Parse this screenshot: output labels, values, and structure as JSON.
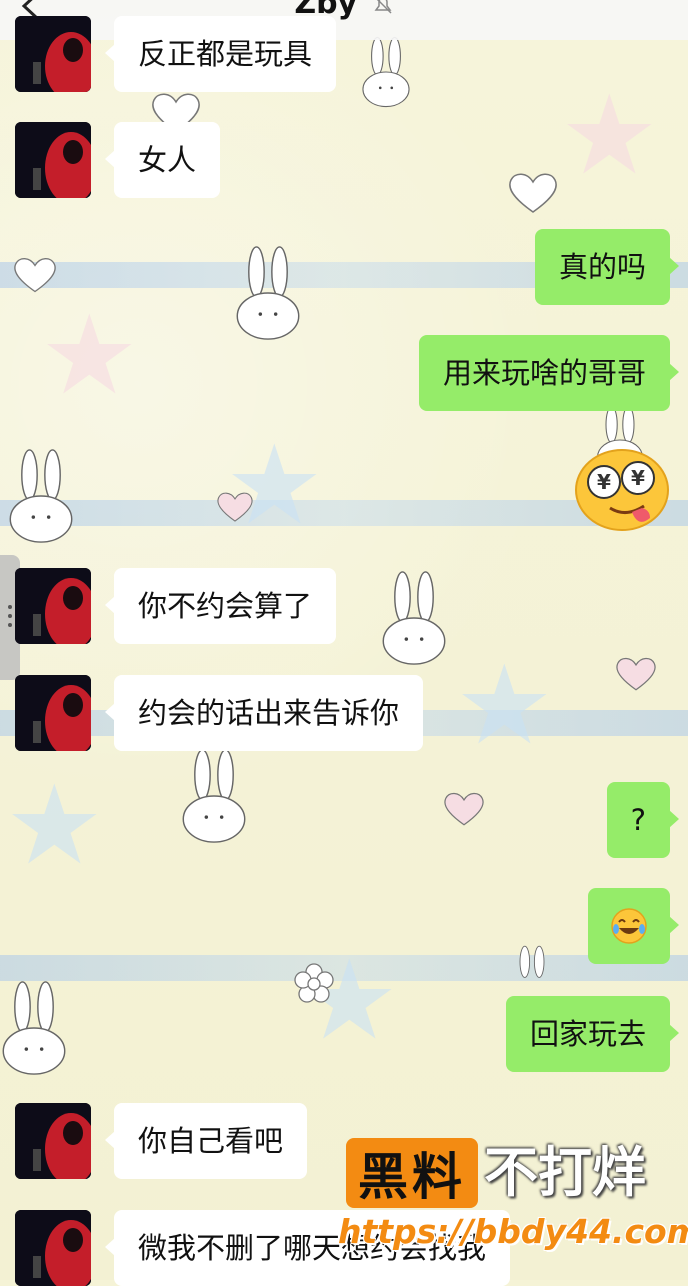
{
  "header": {
    "back_icon": "chevron-left-icon",
    "title": "Zby",
    "title_icon": "bell-mute-icon"
  },
  "messages": [
    {
      "side": "in",
      "text": "反正都是玩具"
    },
    {
      "side": "in",
      "text": "女人"
    },
    {
      "side": "out",
      "text": "真的吗"
    },
    {
      "side": "out",
      "text": "用来玩啥的哥哥"
    },
    {
      "side": "out",
      "sticker": "money-eyes-emoji"
    },
    {
      "side": "in",
      "text": "你不约会算了"
    },
    {
      "side": "in",
      "text": "约会的话出来告诉你"
    },
    {
      "side": "out",
      "text": "?"
    },
    {
      "side": "out",
      "emoji": "laughing-tears-emoji"
    },
    {
      "side": "out",
      "text": "回家玩去"
    },
    {
      "side": "in",
      "text": "你自己看吧"
    },
    {
      "side": "in",
      "text": "微我不删了哪天想约会找我"
    }
  ],
  "watermark": {
    "box_text": "黑料",
    "text": "不打烊",
    "url": "https://bbdy44.com"
  },
  "colors": {
    "outgoing_bubble": "#95ec69",
    "incoming_bubble": "#ffffff",
    "watermark_orange": "#f38b12",
    "wallpaper": "#f5f3d6"
  }
}
